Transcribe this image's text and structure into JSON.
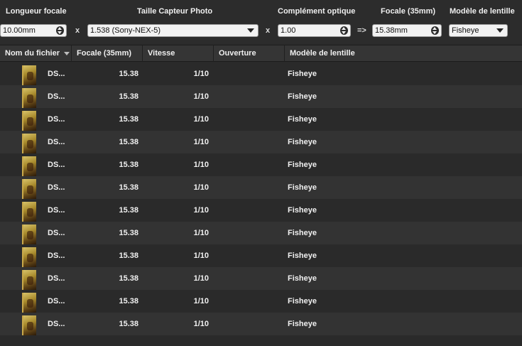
{
  "controls": {
    "focal_length": {
      "label": "Longueur focale",
      "value": "10.00mm"
    },
    "sensor_size": {
      "label": "Taille Capteur Photo",
      "value": "1.538 (Sony-NEX-5)"
    },
    "optical_complement": {
      "label": "Complément optique",
      "value": "1.00"
    },
    "focal_35mm": {
      "label": "Focale (35mm)",
      "value": "15.38mm"
    },
    "lens_model": {
      "label": "Modèle de lentille",
      "value": "Fisheye"
    },
    "multiply_symbol": "x",
    "arrow_symbol": "=>"
  },
  "table": {
    "columns": [
      "Nom du fichier",
      "Focale (35mm)",
      "Vitesse",
      "Ouverture",
      "Modèle de lentille"
    ],
    "rows": [
      {
        "name": "DS...",
        "focal": "15.38",
        "speed": "1/10",
        "aperture": "",
        "model": "Fisheye"
      },
      {
        "name": "DS...",
        "focal": "15.38",
        "speed": "1/10",
        "aperture": "",
        "model": "Fisheye"
      },
      {
        "name": "DS...",
        "focal": "15.38",
        "speed": "1/10",
        "aperture": "",
        "model": "Fisheye"
      },
      {
        "name": "DS...",
        "focal": "15.38",
        "speed": "1/10",
        "aperture": "",
        "model": "Fisheye"
      },
      {
        "name": "DS...",
        "focal": "15.38",
        "speed": "1/10",
        "aperture": "",
        "model": "Fisheye"
      },
      {
        "name": "DS...",
        "focal": "15.38",
        "speed": "1/10",
        "aperture": "",
        "model": "Fisheye"
      },
      {
        "name": "DS...",
        "focal": "15.38",
        "speed": "1/10",
        "aperture": "",
        "model": "Fisheye"
      },
      {
        "name": "DS...",
        "focal": "15.38",
        "speed": "1/10",
        "aperture": "",
        "model": "Fisheye"
      },
      {
        "name": "DS...",
        "focal": "15.38",
        "speed": "1/10",
        "aperture": "",
        "model": "Fisheye"
      },
      {
        "name": "DS...",
        "focal": "15.38",
        "speed": "1/10",
        "aperture": "",
        "model": "Fisheye"
      },
      {
        "name": "DS...",
        "focal": "15.38",
        "speed": "1/10",
        "aperture": "",
        "model": "Fisheye"
      },
      {
        "name": "DS...",
        "focal": "15.38",
        "speed": "1/10",
        "aperture": "",
        "model": "Fisheye"
      }
    ]
  },
  "icons": {
    "stepper": "stepper-icon",
    "dropdown": "chevron-down-icon",
    "sort": "sort-descending-icon",
    "thumbnail": "photo-thumbnail"
  }
}
